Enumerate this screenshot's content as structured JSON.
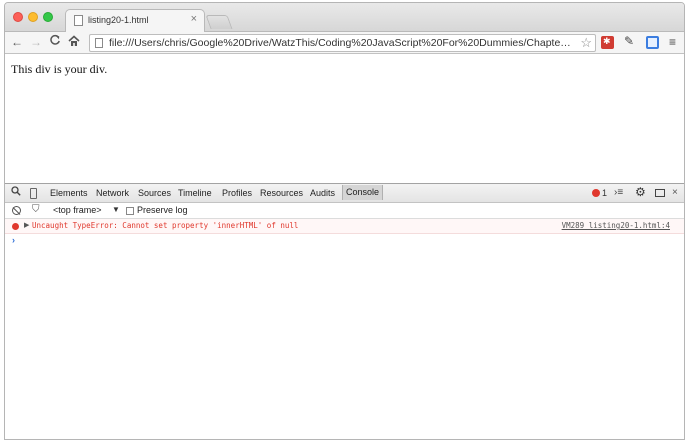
{
  "browser": {
    "tab_title": "listing20-1.html",
    "tab_close": "×",
    "url": "file:///Users/chris/Google%20Drive/WatzThis/Coding%20JavaScript%20For%20Dummies/Chapter...",
    "icons": {
      "back": "←",
      "forward": "→",
      "reload": "C",
      "home": "⌂",
      "star": "☆",
      "dropper": "✎",
      "menu": "≡"
    }
  },
  "page": {
    "text": "This div is your div."
  },
  "devtools": {
    "tabs": [
      "Elements",
      "Network",
      "Sources",
      "Timeline",
      "Profiles",
      "Resources",
      "Audits",
      "Console"
    ],
    "active_tab": "Console",
    "error_count": "1",
    "icons": {
      "search": "🔍",
      "filter": "⛉",
      "drawer": "›≡",
      "settings": "⚙",
      "close": "×",
      "dropdown": "▼",
      "expand": "▶",
      "prompt": "›"
    },
    "console_toolbar": {
      "frame": "<top frame>",
      "preserve_log_label": "Preserve log"
    },
    "console": {
      "error_message": "Uncaught TypeError: Cannot set property 'innerHTML' of null",
      "error_source": "VM289 listing20-1.html:4"
    }
  },
  "colors": {
    "error_red": "#e0382d",
    "prompt_blue": "#2f6fd6",
    "close_light": "#fc5f57",
    "minimize_light": "#fdbc2e",
    "maximize_light": "#33c748"
  }
}
